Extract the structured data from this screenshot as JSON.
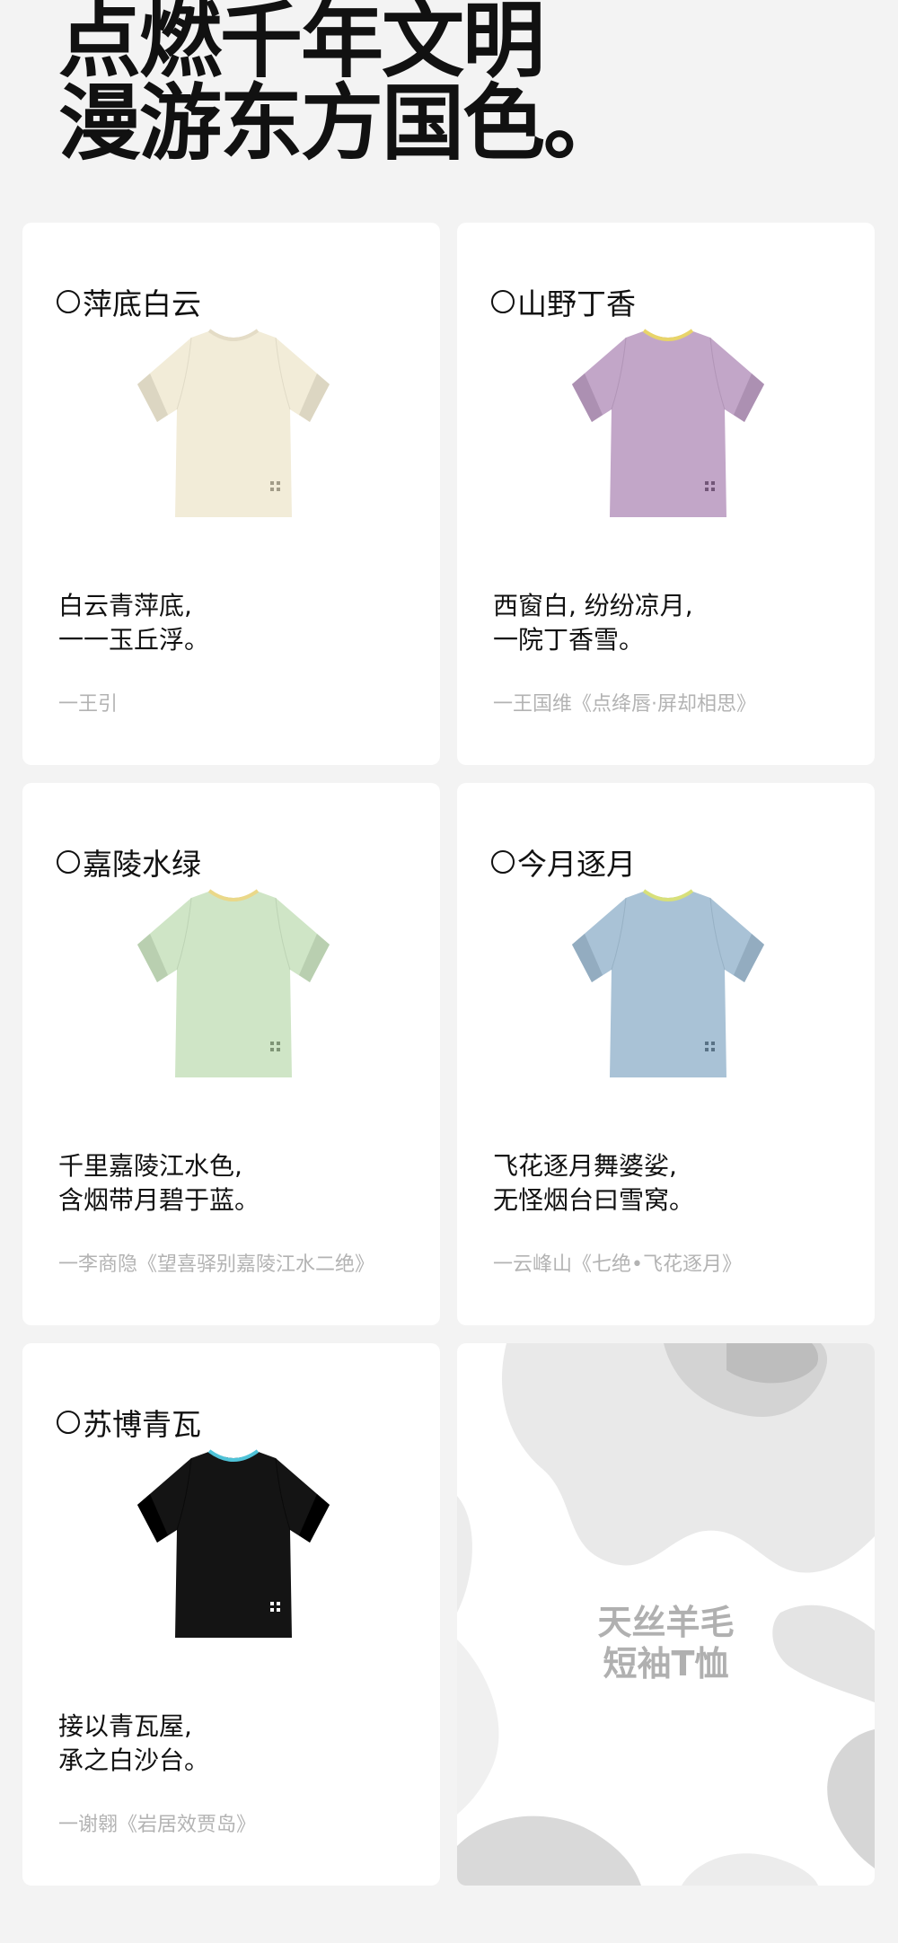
{
  "hero": {
    "line1": "点燃千年文明",
    "line2": "漫游东方国色。"
  },
  "cards": [
    {
      "name": "萍底白云",
      "shirt_color": "#f2ecd8",
      "collar_color": "#e4dcc6",
      "has_logo": true,
      "verse1": "白云青萍底,",
      "verse2": "一一玉丘浮。",
      "author": "一王引"
    },
    {
      "name": "山野丁香",
      "shirt_color": "#c2a6c8",
      "collar_color": "#e8d46a",
      "has_logo": true,
      "verse1": "西窗白, 纷纷凉月,",
      "verse2": "一院丁香雪。",
      "author": "一王国维《点绛唇·屏却相思》"
    },
    {
      "name": "嘉陵水绿",
      "shirt_color": "#cfe5c6",
      "collar_color": "#ead889",
      "has_logo": true,
      "verse1": "千里嘉陵江水色,",
      "verse2": "含烟带月碧于蓝。",
      "author": "一李商隐《望喜驿别嘉陵江水二绝》"
    },
    {
      "name": "今月逐月",
      "shirt_color": "#a9c2d6",
      "collar_color": "#d8e07a",
      "has_logo": true,
      "verse1": "飞花逐月舞婆娑,",
      "verse2": "无怪烟台曰雪窝。",
      "author": "一云峰山《七绝•飞花逐月》"
    },
    {
      "name": "苏博青瓦",
      "shirt_color": "#141414",
      "collar_color": "#4fc3d8",
      "has_logo": true,
      "verse1": "接以青瓦屋,",
      "verse2": "承之白沙台。",
      "author": "一谢翱《岩居效贾岛》"
    }
  ],
  "promo": {
    "line1": "天丝羊毛",
    "line2": "短袖T恤"
  }
}
